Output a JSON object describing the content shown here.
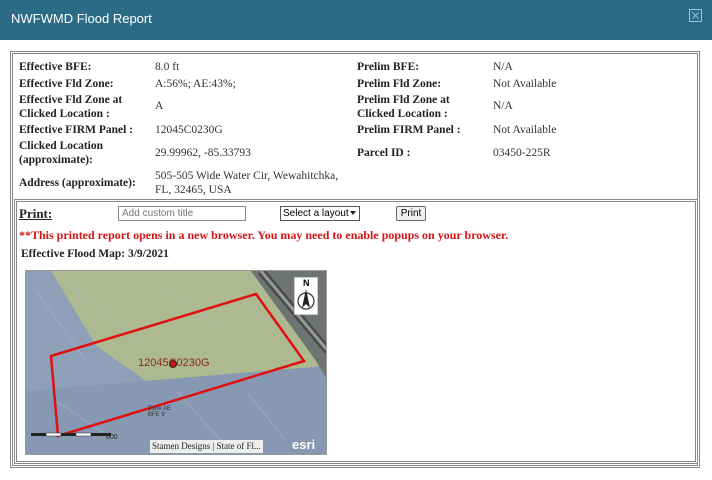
{
  "window": {
    "title": "NWFWMD Flood Report"
  },
  "report": {
    "left": [
      {
        "label": "Effective BFE:",
        "value": "8.0  ft"
      },
      {
        "label": "Effective Fld Zone:",
        "value": "A:56%;  AE:43%;"
      },
      {
        "label": "Effective Fld Zone at",
        "label2": "Clicked Location :",
        "value": "A"
      },
      {
        "label": "Effective FIRM Panel :",
        "value": "12045C0230G"
      },
      {
        "label": "Clicked Location",
        "label2": "(approximate):",
        "value": "29.99962,  -85.33793"
      },
      {
        "label": "Address (approximate):",
        "value": "505-505  Wide  Water  Cir,  Wewahitchka,",
        "value2": "FL,  32465,  USA"
      }
    ],
    "right": [
      {
        "label": "Prelim BFE:",
        "value": "N/A"
      },
      {
        "label": "Prelim Fld Zone:",
        "value": "Not Available"
      },
      {
        "label": "Prelim Fld Zone at",
        "label2": "Clicked Location :",
        "value": "N/A"
      },
      {
        "label": "Prelim FIRM Panel :",
        "value": "Not Available"
      },
      {
        "label": "Parcel ID :",
        "value": "03450-225R"
      }
    ]
  },
  "print": {
    "label": "Print:",
    "title_placeholder": "Add custom title",
    "layout_select": "Select a layout",
    "button": "Print",
    "warning": "**This printed report opens in a new browser. You may need to enable popups on your browser.",
    "flood_map_date": "Effective  Flood  Map:  3/9/2021"
  },
  "map": {
    "panel_label": "12045C0230G",
    "zone_label_1": "Zone AE",
    "zone_label_2": "BFE 9'",
    "scale_label": "600",
    "north_label": "N",
    "attribution": "Stamen Designs  |  State of Fl...",
    "logo": "esri",
    "colors": {
      "zone_ae": "#9aa9c4",
      "zone_a": "#b9c49a",
      "boundary": "#e01010",
      "marker": "#c21a1a"
    }
  }
}
